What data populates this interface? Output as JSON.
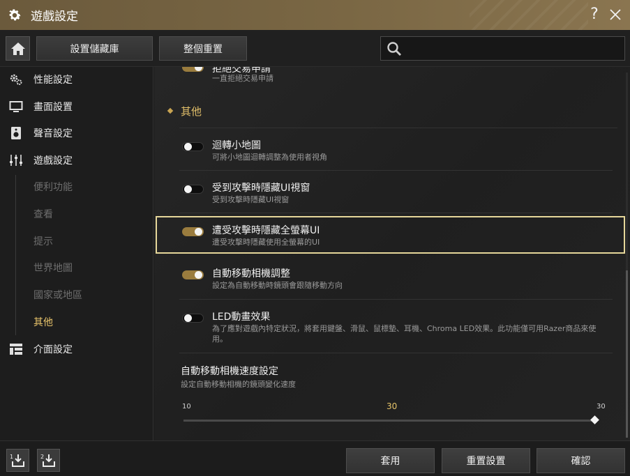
{
  "window": {
    "title": "遊戲設定"
  },
  "toolbar": {
    "save_library_label": "設置儲藏庫",
    "reset_all_label": "整個重置",
    "search_placeholder": "",
    "search_value": ""
  },
  "sidebar": {
    "items": [
      {
        "label": "性能設定",
        "icon": "gears-icon"
      },
      {
        "label": "畫面設置",
        "icon": "monitor-icon"
      },
      {
        "label": "聲音設定",
        "icon": "speaker-icon"
      },
      {
        "label": "遊戲設定",
        "icon": "sliders-icon"
      },
      {
        "label": "介面設定",
        "icon": "layout-icon"
      }
    ],
    "sub_items": [
      {
        "label": "便利功能",
        "active": false
      },
      {
        "label": "查看",
        "active": false
      },
      {
        "label": "提示",
        "active": false
      },
      {
        "label": "世界地圖",
        "active": false
      },
      {
        "label": "國家或地區",
        "active": false
      },
      {
        "label": "其他",
        "active": true
      }
    ]
  },
  "content": {
    "partial_row": {
      "title": "拒絕交易申請",
      "desc": "一直拒絕交易申請",
      "on": true
    },
    "section_title": "其他",
    "rows": [
      {
        "title": "迴轉小地圖",
        "desc": "可將小地圖迴轉調整為使用者視角",
        "on": false
      },
      {
        "title": "受到攻擊時隱藏UI視窗",
        "desc": "受到攻擊時隱藏UI視窗",
        "on": false
      },
      {
        "title": "遭受攻擊時隱藏全螢幕UI",
        "desc": "遭受攻擊時隱藏使用全螢幕的UI",
        "on": true
      },
      {
        "title": "自動移動相機調整",
        "desc": "設定為自動移動時鏡頭會跟隨移動方向",
        "on": true
      },
      {
        "title": "LED動畫效果",
        "desc": "為了應對遊戲內特定狀況，將套用鍵盤、滑鼠、鼠標墊、耳機、Chroma LED效果。此功能僅可用Razer商品來使用。",
        "on": false
      }
    ],
    "speed": {
      "title": "自動移動相機速度設定",
      "desc": "設定自動移動相機的鏡頭變化速度",
      "min": "10",
      "max": "30",
      "value": "30",
      "fraction": 1.0
    }
  },
  "footer": {
    "slot1_label": "1",
    "slot2_label": "2",
    "apply_label": "套用",
    "reset_label": "重置設置",
    "confirm_label": "確認"
  },
  "colors": {
    "accent": "#e3c06a",
    "toggle_on": "#9a7c3e",
    "highlight_border": "#e6d79a",
    "titlebar": "#7a6744"
  }
}
